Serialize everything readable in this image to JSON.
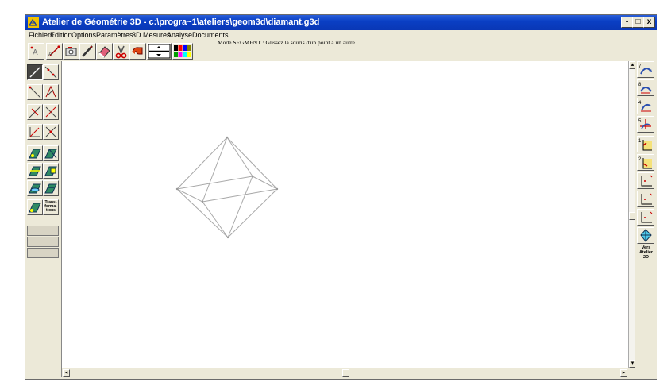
{
  "window": {
    "title": "Atelier de Géométrie 3D - c:\\progra~1\\ateliers\\geom3d\\diamant.g3d",
    "controls": {
      "minimize": "-",
      "restore": "□",
      "close": "x"
    }
  },
  "menu": {
    "items": [
      "Fichiers",
      "Edition",
      "Options",
      "Paramètres",
      "3D",
      "Mesures",
      "Analyse",
      "Documents"
    ]
  },
  "status": {
    "mode_text": "Mode SEGMENT : Glissez la souris d'un point à un autre."
  },
  "toolbar": {
    "tools": [
      "point-tool-icon",
      "move-point-icon",
      "camera-icon",
      "pencil-icon",
      "eraser-icon",
      "scissors-icon",
      "undo-arrow-icon",
      "line-thickness-icon",
      "color-palette-icon"
    ],
    "palette_colors": [
      "#000000",
      "#ff0000",
      "#0000ff",
      "#808000",
      "#00a000",
      "#ff00ff",
      "#00ffff",
      "#ffff00"
    ]
  },
  "left_tools": {
    "transform_label": "Trans-forma-tions"
  },
  "right_tools": {
    "vers_label": "Vers Atelier 2D",
    "view_numbers": [
      "7",
      "8",
      "4",
      "5",
      "1",
      "2"
    ]
  },
  "scene": {
    "shape": "octahedron",
    "edge_color": "#a8a8a8"
  }
}
